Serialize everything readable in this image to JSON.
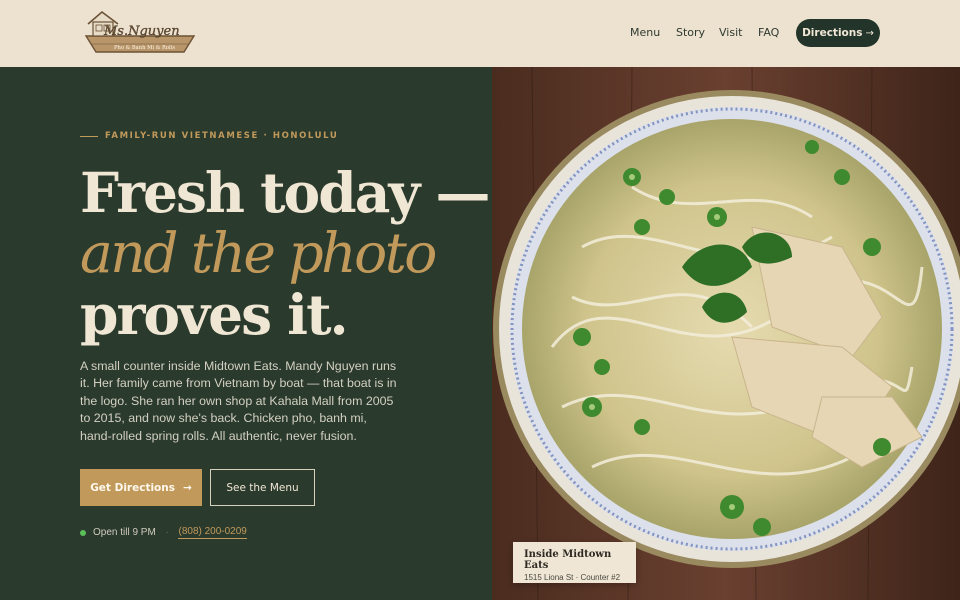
{
  "brand": {
    "logo_text": "Ms.Nguyen",
    "logo_tagline": "Pho & Banh Mi & Rolls"
  },
  "nav": {
    "links": [
      "Menu",
      "Story",
      "Visit",
      "FAQ"
    ],
    "cta_label": "Directions",
    "cta_arrow": "→"
  },
  "hero": {
    "eyebrow": "FAMILY-RUN VIETNAMESE · HONOLULU",
    "headline_line1": "Fresh today —",
    "headline_line2": "and the photo",
    "headline_line3": "proves it.",
    "body": "A small counter inside Midtown Eats. Mandy Nguyen runs it. Her family came from Vietnam by boat — that boat is in the logo. She ran her own shop at Kahala Mall from 2005 to 2015, and now she's back. Chicken pho, banh mi, hand-rolled spring rolls. All authentic, never fusion.",
    "primary_button": "Get Directions",
    "primary_arrow": "→",
    "secondary_button": "See the Menu",
    "status": "Open till 9 PM",
    "separator": "·",
    "phone": "(808) 200-0209"
  },
  "location_card": {
    "title": "Inside Midtown Eats",
    "subtitle": "1515 Liona St · Counter #2"
  },
  "icons": {
    "logo": "boat-logo-icon",
    "status_dot": "open-status-dot-icon",
    "arrow": "arrow-right-icon"
  },
  "colors": {
    "header_bg": "#ede2d0",
    "hero_bg": "#2a3a2d",
    "accent_gold": "#c19a5b",
    "cream_text": "#f0e6d4",
    "dark_button": "#23352a",
    "open_green": "#5bbf5b"
  }
}
